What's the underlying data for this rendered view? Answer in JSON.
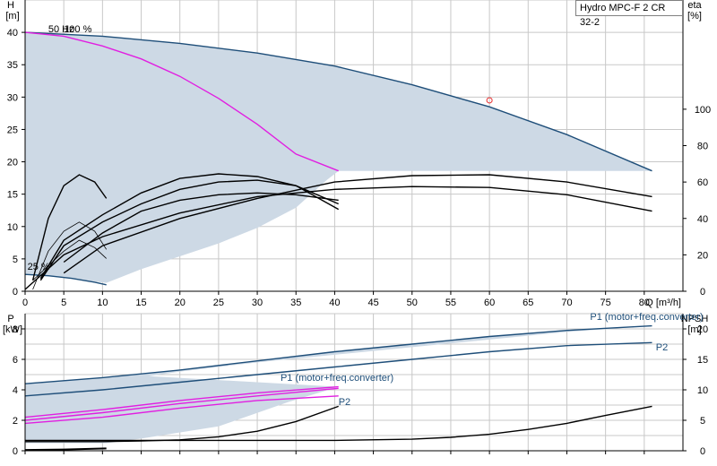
{
  "chart_data": [
    {
      "type": "line",
      "panel": "head",
      "title": "Hydro MPC-F 2 CR 32-2",
      "ylabel": "H",
      "yunit": "[m]",
      "y2label": "eta",
      "y2unit": "[%]",
      "xlabel": "Q [m³/h]",
      "xlim": [
        0,
        85
      ],
      "ylim": [
        0,
        45
      ],
      "y2lim": [
        0,
        160
      ],
      "xticks": [
        0,
        5,
        10,
        15,
        20,
        25,
        30,
        35,
        40,
        45,
        50,
        55,
        60,
        65,
        70,
        75,
        80
      ],
      "yticks": [
        0,
        5,
        10,
        15,
        20,
        25,
        30,
        35,
        40
      ],
      "y2ticks": [
        0,
        20,
        40,
        60,
        80,
        100
      ],
      "grid": true,
      "colors": {
        "band": "#cdd9e5",
        "curve": "#1e4e79",
        "speed": "#e11fe1",
        "eff": "#000000",
        "duty": "#e8292b"
      },
      "annotations": [
        {
          "text": "50 Hz",
          "x": 3,
          "y": 40
        },
        {
          "text": "100 %",
          "x": 5,
          "y": 40
        },
        {
          "text": "25 %",
          "x": 0.3,
          "y": 3.3
        }
      ],
      "band": {
        "upper": [
          [
            0,
            40
          ],
          [
            10,
            39.4
          ],
          [
            20,
            38.3
          ],
          [
            30,
            36.8
          ],
          [
            40,
            34.8
          ],
          [
            50,
            31.9
          ],
          [
            60,
            28.5
          ],
          [
            70,
            24.2
          ],
          [
            81,
            18.6
          ]
        ],
        "lower": [
          [
            81,
            18.6
          ],
          [
            40.5,
            18.6
          ],
          [
            39,
            17.2
          ],
          [
            35,
            12.9
          ],
          [
            30,
            9.8
          ],
          [
            25,
            7.4
          ],
          [
            20,
            5.4
          ],
          [
            15,
            3.4
          ],
          [
            10.5,
            1.3
          ],
          [
            7,
            1.8
          ],
          [
            4,
            2.2
          ],
          [
            0,
            2.6
          ]
        ]
      },
      "series": [
        {
          "role": "full-speed-QH",
          "color": "#1e4e79",
          "x": [
            0,
            10,
            20,
            30,
            40,
            50,
            60,
            70,
            81
          ],
          "y": [
            40,
            39.4,
            38.3,
            36.8,
            34.8,
            31.9,
            28.5,
            24.2,
            18.6
          ]
        },
        {
          "role": "single-pump-QH",
          "color": "#e11fe1",
          "x": [
            0,
            5,
            10,
            15,
            20,
            25,
            30,
            35,
            40.5
          ],
          "y": [
            40,
            39.4,
            37.9,
            35.9,
            33.2,
            29.8,
            25.8,
            21.2,
            18.6
          ]
        },
        {
          "role": "min-speed-QH",
          "color": "#1e4e79",
          "x": [
            0,
            3,
            6,
            9,
            10.5
          ],
          "y": [
            2.6,
            2.4,
            2.0,
            1.4,
            1.0
          ]
        },
        {
          "role": "duty-point",
          "color": "#e8292b",
          "x": [
            60
          ],
          "y": [
            29.5
          ]
        },
        {
          "role": "eta-total",
          "axis": "y2",
          "color": "#000000",
          "x": [
            0,
            5,
            10,
            20,
            30,
            40,
            50,
            60,
            70,
            81
          ],
          "y": [
            1,
            20,
            30,
            43,
            52,
            56,
            57.5,
            57,
            53,
            44
          ]
        },
        {
          "role": "eta-pump",
          "axis": "y2",
          "color": "#000000",
          "x": [
            5,
            10,
            20,
            30,
            40,
            50,
            60,
            70,
            81
          ],
          "y": [
            10,
            25,
            40,
            51,
            60,
            63.5,
            64,
            60,
            52
          ]
        },
        {
          "role": "eta-single-total",
          "axis": "y2",
          "color": "#000000",
          "x": [
            2,
            5,
            10,
            15,
            20,
            25,
            30,
            35,
            40.5
          ],
          "y": [
            6,
            25,
            38,
            48,
            56,
            60,
            61,
            58,
            48
          ]
        },
        {
          "role": "eta-single-pump",
          "axis": "y2",
          "color": "#000000",
          "x": [
            2,
            5,
            10,
            15,
            20,
            25,
            30,
            35,
            40.5
          ],
          "y": [
            7,
            28,
            42,
            54,
            62,
            64.5,
            63,
            58,
            45
          ]
        },
        {
          "role": "eta-single-aux",
          "axis": "y2",
          "color": "#000000",
          "x": [
            5,
            10,
            15,
            20,
            25,
            30,
            35,
            40.5
          ],
          "y": [
            16,
            32,
            44,
            50,
            53,
            54,
            53,
            50
          ]
        },
        {
          "role": "eta-low-speed",
          "axis": "y2",
          "color": "#000000",
          "x": [
            1,
            3,
            5,
            7,
            9,
            10.5
          ],
          "y": [
            1,
            22,
            33,
            38,
            33,
            23
          ]
        },
        {
          "role": "eta-low-speed-2",
          "axis": "y2",
          "color": "#000000",
          "x": [
            1,
            3,
            5,
            7,
            9,
            10.5
          ],
          "y": [
            6,
            14,
            22,
            28,
            24,
            18
          ]
        },
        {
          "role": "eta-min-speed",
          "axis": "y2",
          "color": "#000000",
          "x": [
            1,
            3,
            5,
            7,
            9,
            10.5
          ],
          "y": [
            6,
            40,
            58,
            64,
            60,
            51
          ]
        }
      ]
    },
    {
      "type": "line",
      "panel": "power",
      "ylabel": "P",
      "yunit": "[kW]",
      "y2label": "NPSH",
      "y2unit": "[m]",
      "xlim": [
        0,
        85
      ],
      "ylim": [
        0,
        9
      ],
      "y2lim": [
        0,
        22.5
      ],
      "yticks": [
        0,
        2,
        4,
        6,
        8
      ],
      "y2ticks": [
        0,
        5,
        10,
        15,
        20
      ],
      "grid": true,
      "annotations": [
        {
          "text": "P1 (motor+freq.converter)",
          "x": 73,
          "y": 8.6,
          "color": "#1e4e79"
        },
        {
          "text": "P2",
          "x": 81.5,
          "y": 6.6,
          "color": "#1e4e79"
        },
        {
          "text": "P1 (motor+freq.converter)",
          "x": 33,
          "y": 4.6,
          "color": "#1e4e79"
        },
        {
          "text": "P2",
          "x": 40.5,
          "y": 3.0,
          "color": "#1e4e79"
        }
      ],
      "band": {
        "upper": [
          [
            0,
            4.4
          ],
          [
            10,
            4.8
          ],
          [
            20,
            5.3
          ],
          [
            30,
            5.9
          ],
          [
            40,
            6.5
          ],
          [
            50,
            7.0
          ],
          [
            60,
            7.5
          ],
          [
            70,
            7.9
          ],
          [
            81,
            8.2
          ]
        ],
        "lower": [
          [
            81,
            8.2
          ],
          [
            70,
            7.8
          ],
          [
            60,
            7.3
          ],
          [
            50,
            6.8
          ],
          [
            40,
            6.3
          ],
          [
            30,
            5.8
          ],
          [
            20,
            5.2
          ],
          [
            16,
            4.9
          ],
          [
            30,
            4.5
          ],
          [
            40.5,
            4.2
          ],
          [
            34,
            3.2
          ],
          [
            25,
            1.6
          ],
          [
            15,
            0.8
          ],
          [
            10.5,
            0.5
          ],
          [
            5,
            0.5
          ],
          [
            0,
            0.5
          ]
        ]
      },
      "series": [
        {
          "role": "P1-full",
          "color": "#1e4e79",
          "x": [
            0,
            10,
            20,
            30,
            40,
            50,
            60,
            70,
            81
          ],
          "y": [
            4.4,
            4.8,
            5.3,
            5.9,
            6.5,
            7.0,
            7.5,
            7.9,
            8.2
          ]
        },
        {
          "role": "P2-full",
          "color": "#1e4e79",
          "x": [
            0,
            10,
            20,
            30,
            40,
            50,
            60,
            70,
            81
          ],
          "y": [
            3.6,
            4.0,
            4.5,
            5.0,
            5.5,
            6.0,
            6.5,
            6.9,
            7.1
          ]
        },
        {
          "role": "P1-single",
          "color": "#e11fe1",
          "x": [
            0,
            10,
            20,
            30,
            40.5
          ],
          "y": [
            2.2,
            2.7,
            3.3,
            3.8,
            4.2
          ]
        },
        {
          "role": "P2-single",
          "color": "#e11fe1",
          "x": [
            0,
            10,
            20,
            30,
            40.5
          ],
          "y": [
            1.8,
            2.2,
            2.8,
            3.3,
            3.6
          ]
        },
        {
          "role": "P1-single-2",
          "color": "#e11fe1",
          "x": [
            0,
            10,
            20,
            30,
            40.5
          ],
          "y": [
            2.0,
            2.5,
            3.1,
            3.6,
            4.1
          ]
        },
        {
          "role": "P-min",
          "color": "#000000",
          "x": [
            0,
            5,
            10.5
          ],
          "y": [
            0.05,
            0.08,
            0.15
          ]
        },
        {
          "role": "NPSH",
          "axis": "y2",
          "color": "#000000",
          "x": [
            0,
            10,
            20,
            30,
            40,
            50,
            55,
            60,
            65,
            70,
            75,
            81
          ],
          "y": [
            1.7,
            1.7,
            1.7,
            1.7,
            1.7,
            1.9,
            2.2,
            2.7,
            3.5,
            4.5,
            5.8,
            7.3
          ]
        },
        {
          "role": "NPSH-single",
          "axis": "y2",
          "color": "#000000",
          "x": [
            0,
            10,
            15,
            20,
            25,
            30,
            35,
            40.5
          ],
          "y": [
            1.5,
            1.5,
            1.6,
            1.8,
            2.3,
            3.2,
            4.8,
            7.3
          ]
        }
      ]
    }
  ]
}
